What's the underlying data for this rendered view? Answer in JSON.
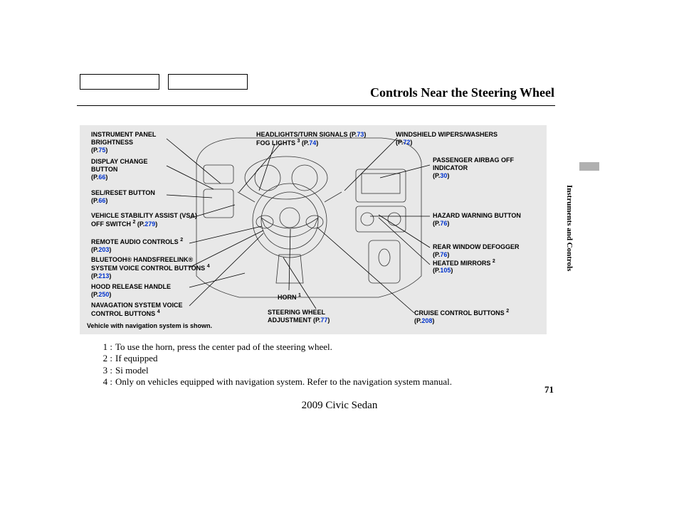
{
  "header": {
    "title": "Controls Near the Steering Wheel"
  },
  "section_tab": "Instruments and Controls",
  "diagram": {
    "note": "Vehicle with navigation system is shown.",
    "callouts_left": [
      {
        "label": "INSTRUMENT PANEL BRIGHTNESS",
        "pages": [
          "75"
        ],
        "sup": ""
      },
      {
        "label": "DISPLAY CHANGE BUTTON",
        "pages": [
          "66"
        ],
        "sup": ""
      },
      {
        "label": "SEL/RESET BUTTON",
        "pages": [
          "66"
        ],
        "sup": ""
      },
      {
        "label": "VEHICLE STABILITY ASSIST (VSA) OFF SWITCH",
        "pages": [
          "279"
        ],
        "sup": "2"
      },
      {
        "label": "REMOTE AUDIO CONTROLS",
        "pages": [
          "203"
        ],
        "sup": "2"
      },
      {
        "label": "BLUETOOH® HANDSFREELINK® SYSTEM VOICE CONTROL BUTTONS",
        "pages": [
          "213"
        ],
        "sup": "4"
      },
      {
        "label": "HOOD RELEASE HANDLE",
        "pages": [
          "250"
        ],
        "sup": ""
      },
      {
        "label": "NAVAGATION SYSTEM VOICE CONTROL BUTTONS",
        "pages": [],
        "sup": "4"
      }
    ],
    "callouts_center": [
      {
        "label": "HEADLIGHTS/TURN SIGNALS",
        "pages": [
          "73"
        ],
        "sup": ""
      },
      {
        "label": "FOG LIGHTS",
        "pages": [
          "74"
        ],
        "sup": "3"
      },
      {
        "label": "HORN",
        "pages": [],
        "sup": "1"
      },
      {
        "label": "STEERING WHEEL ADJUSTMENT",
        "pages": [
          "77"
        ],
        "sup": ""
      }
    ],
    "callouts_right": [
      {
        "label": "WINDSHIELD WIPERS/WASHERS",
        "pages": [
          "72"
        ],
        "sup": ""
      },
      {
        "label": "PASSENGER AIRBAG OFF INDICATOR",
        "pages": [
          "30"
        ],
        "sup": ""
      },
      {
        "label": "HAZARD WARNING BUTTON",
        "pages": [
          "76"
        ],
        "sup": ""
      },
      {
        "label": "REAR WINDOW DEFOGGER",
        "pages": [
          "76"
        ],
        "sup": ""
      },
      {
        "label": "HEATED MIRRORS",
        "pages": [
          "105"
        ],
        "sup": "2"
      },
      {
        "label": "CRUISE CONTROL BUTTONS",
        "pages": [
          "208"
        ],
        "sup": "2"
      }
    ]
  },
  "footnotes": [
    {
      "num": "1",
      "text": "To use the horn, press the center pad of the steering wheel."
    },
    {
      "num": "2",
      "text": "If equipped"
    },
    {
      "num": "3",
      "text": "Si model"
    },
    {
      "num": "4",
      "text": "Only on vehicles equipped with navigation system. Refer to the navigation system manual."
    }
  ],
  "page_number": "71",
  "model_line": "2009  Civic  Sedan"
}
